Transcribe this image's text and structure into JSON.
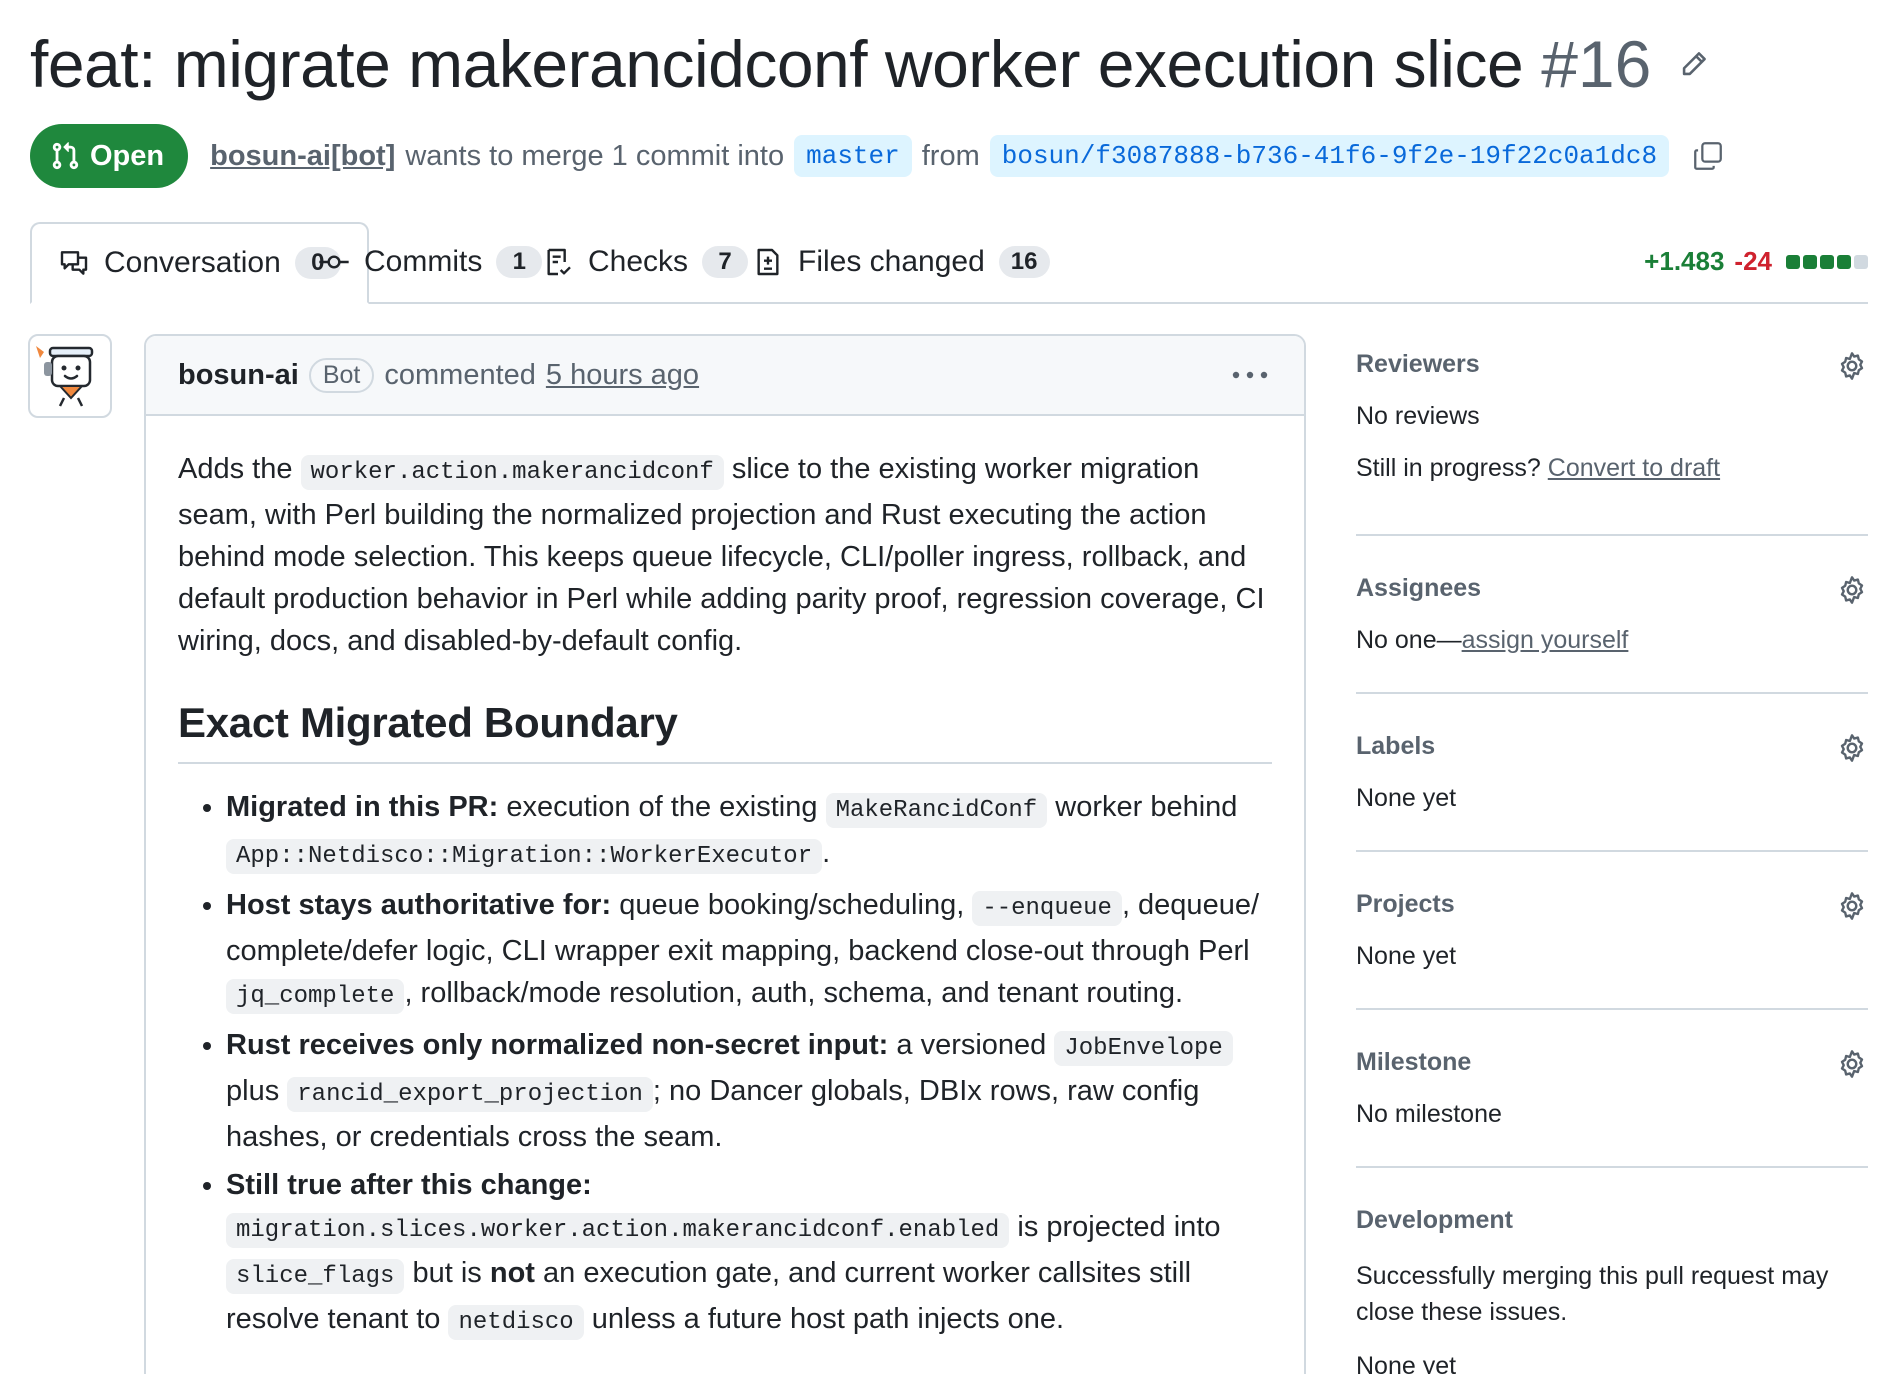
{
  "pr": {
    "title": "feat: migrate makerancidconf worker execution slice",
    "number": "#16",
    "state_label": "Open",
    "author": "bosun-ai[bot]",
    "merge_text": "wants to merge 1 commit into",
    "base_branch": "master",
    "from_text": "from",
    "head_branch": "bosun/f3087888-b736-41f6-9f2e-19f22c0a1dc8"
  },
  "tabs": [
    {
      "label": "Conversation",
      "count": "0"
    },
    {
      "label": "Commits",
      "count": "1"
    },
    {
      "label": "Checks",
      "count": "7"
    },
    {
      "label": "Files changed",
      "count": "16"
    }
  ],
  "diffstat": {
    "additions": "+1.483",
    "deletions": "-24",
    "blocks": [
      "#1a7f37",
      "#1a7f37",
      "#1a7f37",
      "#1a7f37",
      "#d1d9e0"
    ]
  },
  "comment": {
    "author": "bosun-ai",
    "bot_label": "Bot",
    "action": "commented",
    "time": "5 hours ago",
    "intro": {
      "t1": "Adds the ",
      "c1": "worker.action.makerancidconf",
      "t2": " slice to the existing worker migration seam, with Perl building the normalized projection and Rust executing the action behind mode selection. This keeps queue lifecycle, CLI/poller ingress, rollback, and default production behavior in Perl while adding parity proof, regression coverage, CI wiring, docs, and disabled-by-default config."
    },
    "heading": "Exact Migrated Boundary",
    "bullets": {
      "b1": {
        "bold": "Migrated in this PR:",
        "t1": " execution of the existing ",
        "c1": "MakeRancidConf",
        "t2": " worker behind ",
        "c2": "App::Netdisco::Migration::WorkerExecutor",
        "t3": "."
      },
      "b2": {
        "bold": "Host stays authoritative for:",
        "t1": " queue booking/scheduling, ",
        "c1": "--enqueue",
        "t2": ", dequeue/ complete/defer logic, CLI wrapper exit mapping, backend close-out through Perl ",
        "c2": "jq_complete",
        "t3": ", rollback/mode resolution, auth, schema, and tenant routing."
      },
      "b3": {
        "bold": "Rust receives only normalized non-secret input:",
        "t1": " a versioned ",
        "c1": "JobEnvelope",
        "t2": " plus ",
        "c2": "rancid_export_projection",
        "t3": "; no Dancer globals, DBIx rows, raw config hashes, or credentials cross the seam."
      },
      "b4": {
        "bold": "Still true after this change:",
        "t0": " ",
        "c1": "migration.slices.worker.action.makerancidconf.enabled",
        "t1": " is projected into ",
        "c2": "slice_flags",
        "t2": " but is ",
        "bold2": "not",
        "t3": " an execution gate, and current worker callsites still resolve tenant to ",
        "c3": "netdisco",
        "t4": " unless a future host path injects one."
      }
    }
  },
  "sidebar": {
    "reviewers": {
      "heading": "Reviewers",
      "value": "No reviews",
      "progress_text": "Still in progress?",
      "progress_link": "Convert to draft"
    },
    "assignees": {
      "heading": "Assignees",
      "value": "No one—",
      "link": "assign yourself"
    },
    "labels": {
      "heading": "Labels",
      "value": "None yet"
    },
    "projects": {
      "heading": "Projects",
      "value": "None yet"
    },
    "milestone": {
      "heading": "Milestone",
      "value": "No milestone"
    },
    "development": {
      "heading": "Development",
      "text": "Successfully merging this pull request may close these issues.",
      "value": "None yet"
    }
  }
}
